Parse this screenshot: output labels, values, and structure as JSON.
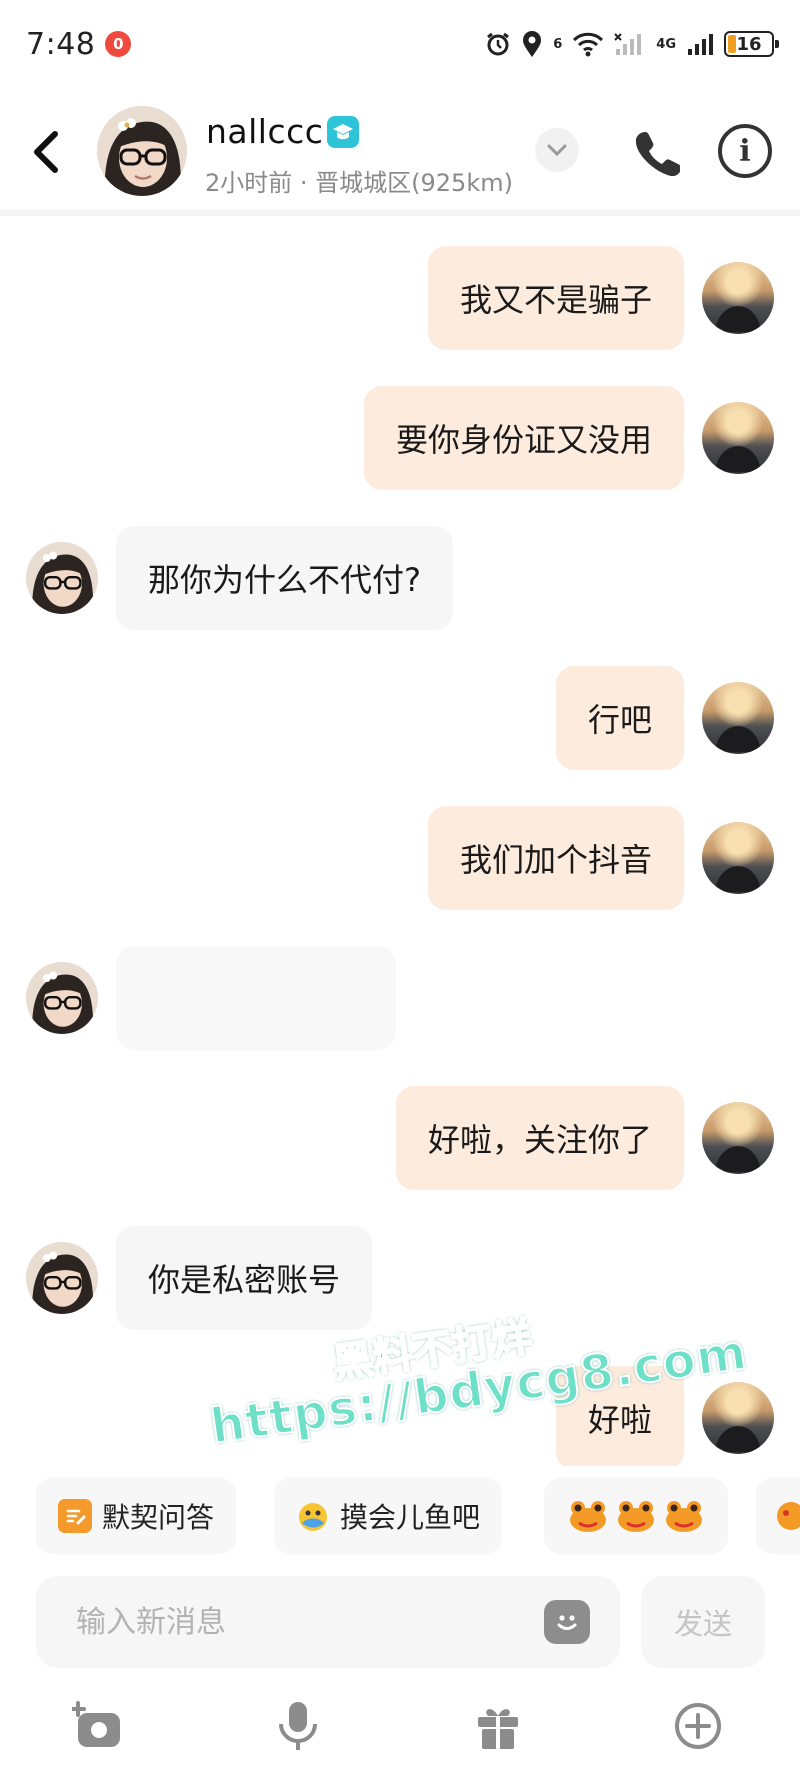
{
  "status_bar": {
    "time": "7:48",
    "notification_count": "0",
    "network_label": "4G",
    "wifi_label": "6",
    "battery_level": "16"
  },
  "header": {
    "name": "nallccc",
    "status": "2小时前 · 晋城城区(925km)"
  },
  "messages": [
    {
      "side": "out",
      "text": "我又不是骗子"
    },
    {
      "side": "out",
      "text": "要你身份证又没用"
    },
    {
      "side": "in",
      "text": "那你为什么不代付?"
    },
    {
      "side": "out",
      "text": "行吧"
    },
    {
      "side": "out",
      "text": "我们加个抖音"
    },
    {
      "side": "in",
      "text": ""
    },
    {
      "side": "out",
      "text": "好啦，关注你了"
    },
    {
      "side": "in",
      "text": "你是私密账号"
    },
    {
      "side": "out",
      "text": "好啦"
    }
  ],
  "watermark": {
    "line1": "黑料不打烊",
    "line2": "https://bdycg8.com"
  },
  "quick_replies": {
    "items": [
      "默契问答",
      "摸会儿鱼吧"
    ]
  },
  "composer": {
    "placeholder": "输入新消息",
    "send_label": "发送"
  },
  "colors": {
    "outgoing_bubble": "#fdebdd",
    "incoming_bubble": "#f6f6f6",
    "verified_badge": "#2ec4d8",
    "notification_badge": "#f0493d"
  }
}
